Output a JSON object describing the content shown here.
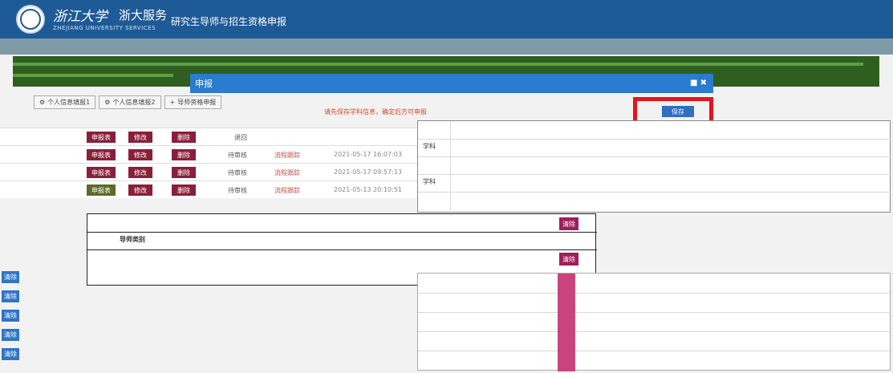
{
  "header": {
    "script_name": "浙江大学",
    "brand": "浙大服务",
    "brand_en": "ZHEJIANG UNIVERSITY SERVICES",
    "system_title": "研究生导师与招生资格申报"
  },
  "tabs": [
    "个人信息填报1",
    "个人信息填报2",
    "导师资格申报"
  ],
  "bg_rows": [
    {
      "b1": "申报表",
      "b2": "修改",
      "b3": "删除",
      "status": "退回",
      "flow": "",
      "time": ""
    },
    {
      "b1": "申报表",
      "b2": "修改",
      "b3": "删除",
      "status": "待审核",
      "flow": "流程跟踪",
      "time": "2021-05-17 16:07:03"
    },
    {
      "b1": "申报表",
      "b2": "修改",
      "b3": "删除",
      "status": "待审核",
      "flow": "流程跟踪",
      "time": "2021-05-17 09:57:13"
    },
    {
      "b1": "申报表",
      "b2": "修改",
      "b3": "删除",
      "status": "待审核",
      "flow": "流程跟踪",
      "time": "2021-05-13 20:10:51"
    }
  ],
  "modal": {
    "title": "申报",
    "warning": "请先保存学科信息，确定后方可申报",
    "save_label": "保存"
  },
  "clear_label": "清除",
  "section_labels": [
    "学科",
    "学科",
    "导师类别"
  ],
  "accent": {
    "header": "#1e5a96",
    "modal": "#2b7bd0",
    "danger": "#9e1f5a",
    "highlight": "#e5141b"
  }
}
